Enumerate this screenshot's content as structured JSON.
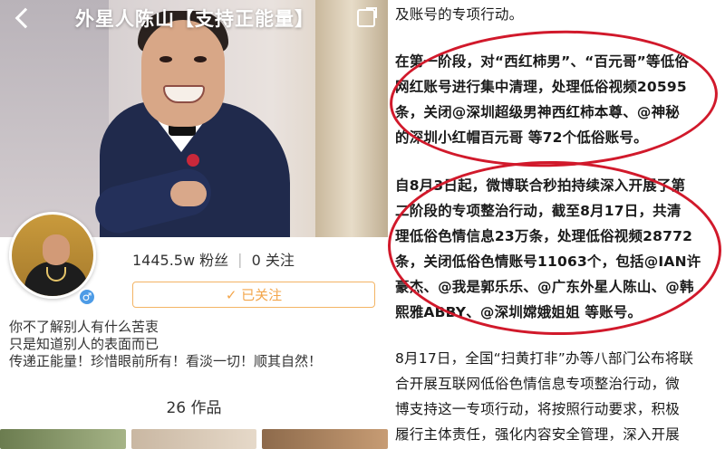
{
  "left_panel": {
    "header": {
      "title": "外星人陈山【支持正能量】"
    },
    "profile": {
      "followers": "1445.5w 粉丝",
      "following": "0 关注",
      "follow_button": "✓ 已关注",
      "gender_icon": "male-icon",
      "bio": [
        "你不了解别人有什么苦衷",
        "只是知道别人的表面而已",
        "传递正能量！珍惜眼前所有！看淡一切！顺其自然！"
      ],
      "works": "26 作品"
    }
  },
  "right_panel": {
    "lines": [
      "及账号的专项行动。",
      "在第一阶段，对“西红柿男”、“百元哥”等低俗",
      "网红账号进行集中清理，处理低俗视频20595",
      "条，关闭@深圳超级男神西红柿本尊、@神秘",
      "的深圳小红帽百元哥 等72个低俗账号。",
      "自8月3日起，微博联合秒拍持续深入开展了第",
      "二阶段的专项整治行动，截至8月17日，共清",
      "理低俗色情信息23万条，处理低俗视频28772",
      "条，关闭低俗色情账号11063个，包括@IAN许",
      "豪杰、@我是郭乐乐、@广东外星人陈山、@韩",
      "熙雅ABBY、@深圳嫦娥姐姐 等账号。",
      "8月17日，全国“扫黄打非”办等八部门公布将联",
      "合开展互联网低俗色情信息专项整治行动，微",
      "博支持这一专项行动，将按照行动要求，积极",
      "履行主体责任，强化内容安全管理，深入开展"
    ]
  },
  "colors": {
    "highlight_oval": "#d1192b",
    "follow_accent": "#f3a54a",
    "gender_badge": "#4d9be6"
  }
}
